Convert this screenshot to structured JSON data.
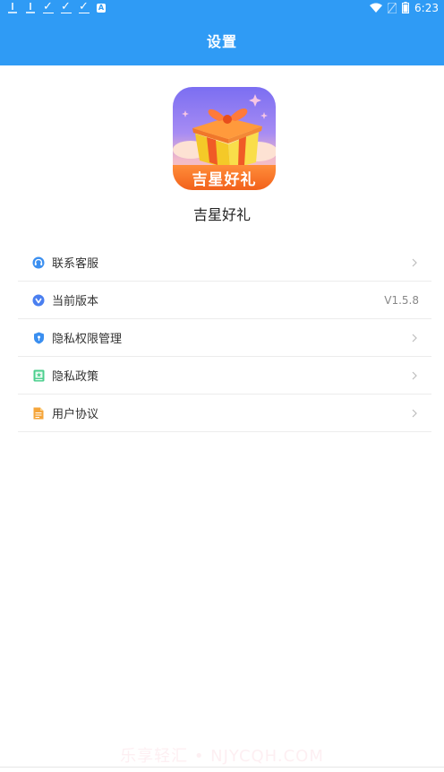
{
  "status_bar": {
    "time": "6:23",
    "left_icons": [
      "download-icon",
      "download-icon",
      "check-icon",
      "check-icon",
      "check-icon",
      "a-icon"
    ],
    "right_icons": [
      "wifi-icon",
      "sim-icon",
      "battery-icon"
    ]
  },
  "header": {
    "title": "设置",
    "background": "#2f9bf5"
  },
  "app": {
    "logo_text": "吉星好礼",
    "name": "吉星好礼"
  },
  "menu": {
    "items": [
      {
        "label": "联系客服",
        "icon": "customer-service-icon",
        "icon_color": "#3b8ff0",
        "right": "chevron"
      },
      {
        "label": "当前版本",
        "icon": "version-icon",
        "icon_color": "#4a7ff0",
        "right": "value",
        "value": "V1.5.8"
      },
      {
        "label": "隐私权限管理",
        "icon": "shield-icon",
        "icon_color": "#3b8ff0",
        "right": "chevron"
      },
      {
        "label": "隐私政策",
        "icon": "policy-icon",
        "icon_color": "#4ccf8e",
        "right": "chevron"
      },
      {
        "label": "用户协议",
        "icon": "agreement-icon",
        "icon_color": "#f5a53a",
        "right": "chevron"
      }
    ]
  },
  "watermark": "乐享轻汇 • NJYCQH.COM"
}
